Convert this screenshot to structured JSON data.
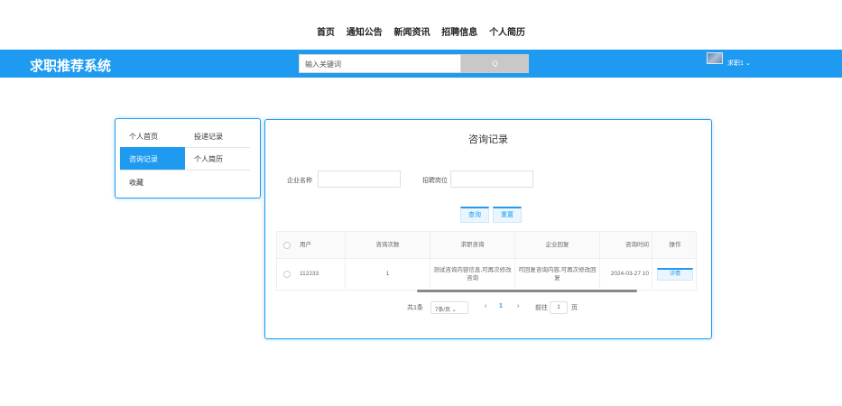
{
  "nav": [
    "首页",
    "通知公告",
    "新闻资讯",
    "招聘信息",
    "个人简历"
  ],
  "header": {
    "brand": "求职推荐系统",
    "search_placeholder": "输入关键词",
    "search_button": "Q",
    "user_label": "求职1 ⌄"
  },
  "sidebar": {
    "items": [
      {
        "label": "个人首页",
        "active": false
      },
      {
        "label": "投递记录",
        "active": false
      },
      {
        "label": "咨询记录",
        "active": true
      },
      {
        "label": "个人简历",
        "active": false
      },
      {
        "label": "收藏",
        "active": false
      }
    ]
  },
  "main": {
    "title": "咨询记录",
    "filters": {
      "company_label": "企业名称",
      "position_label": "招聘岗位"
    },
    "buttons": {
      "search": "查询",
      "reset": "重置"
    },
    "table": {
      "headers": [
        "",
        "用户",
        "咨询次数",
        "求职咨询",
        "企业回复",
        "咨询时间",
        "操作"
      ],
      "rows": [
        {
          "user": "112233",
          "count": "1",
          "question": "测试咨询内容信息,可再次修改咨询",
          "reply": "可回复咨询内容,可再次修改回复",
          "time": "2024-03-27 10",
          "action": "详情"
        }
      ]
    },
    "pagination": {
      "total": "共1条",
      "page_size": "7条/页 ⌄",
      "prev": "‹",
      "current": "1",
      "next": "›",
      "goto_label": "前往",
      "goto_value": "1",
      "page_unit": "页"
    }
  },
  "colors": {
    "accent": "#1e9bf0"
  }
}
